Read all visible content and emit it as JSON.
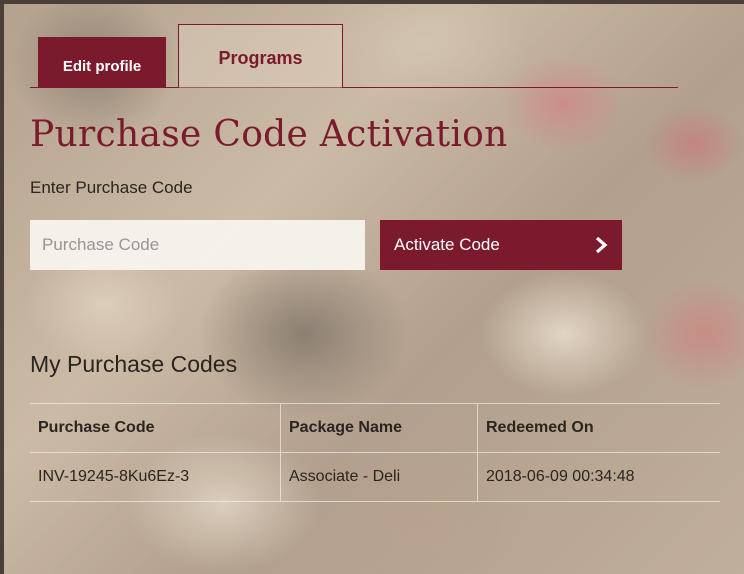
{
  "tabs": [
    {
      "label": "Edit profile",
      "active": false
    },
    {
      "label": "Programs",
      "active": true
    }
  ],
  "page": {
    "title": "Purchase Code Activation",
    "enter_label": "Enter Purchase Code"
  },
  "form": {
    "input_placeholder": "Purchase Code",
    "input_value": "",
    "activate_label": "Activate Code",
    "button_icon": "chevron-right-icon"
  },
  "codes_section": {
    "title": "My Purchase Codes",
    "columns": [
      "Purchase Code",
      "Package Name",
      "Redeemed On"
    ],
    "rows": [
      {
        "code": "INV-19245-8Ku6Ez-3",
        "package": "Associate - Deli",
        "redeemed": "2018-06-09 00:34:48"
      }
    ]
  },
  "colors": {
    "accent": "#7a1a2c",
    "text": "#2b2420",
    "input_bg": "#f7f3ee"
  }
}
